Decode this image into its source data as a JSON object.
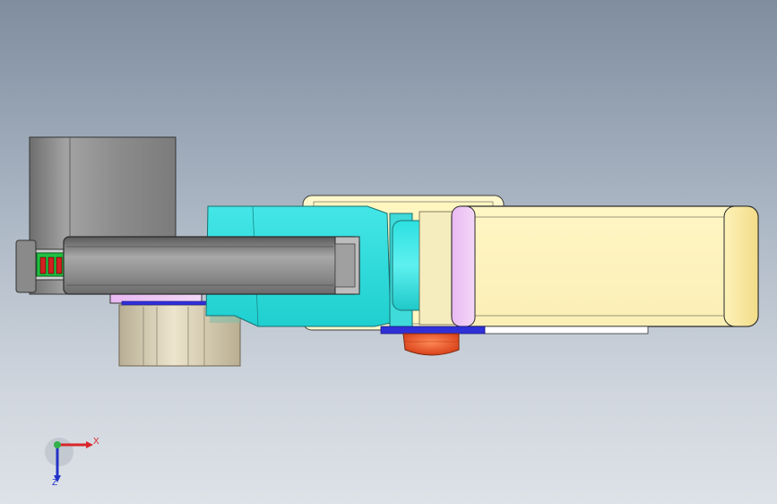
{
  "app": "SolidWorks",
  "view": {
    "background_top": "#7f8d9f",
    "background_bottom": "#dde2e7"
  },
  "triad": {
    "x_label": "X",
    "z_label": "Z",
    "x_color": "#d8262b",
    "y_color": "#33b04a",
    "z_color": "#2233c8"
  },
  "model": {
    "parts": [
      "base-motor-housing",
      "shoulder-link",
      "elbow-joint-cover",
      "elbow-motor",
      "forearm-link",
      "tool-flange",
      "base-flange"
    ],
    "colors": {
      "housing": "#8e8e8e",
      "joint": "#33dede",
      "forearm": "#fff7c2",
      "flange_pink": "#ee88ee",
      "flange_blue": "#3030d8",
      "tool": "#e8501e",
      "base": "#d8ccab"
    }
  }
}
